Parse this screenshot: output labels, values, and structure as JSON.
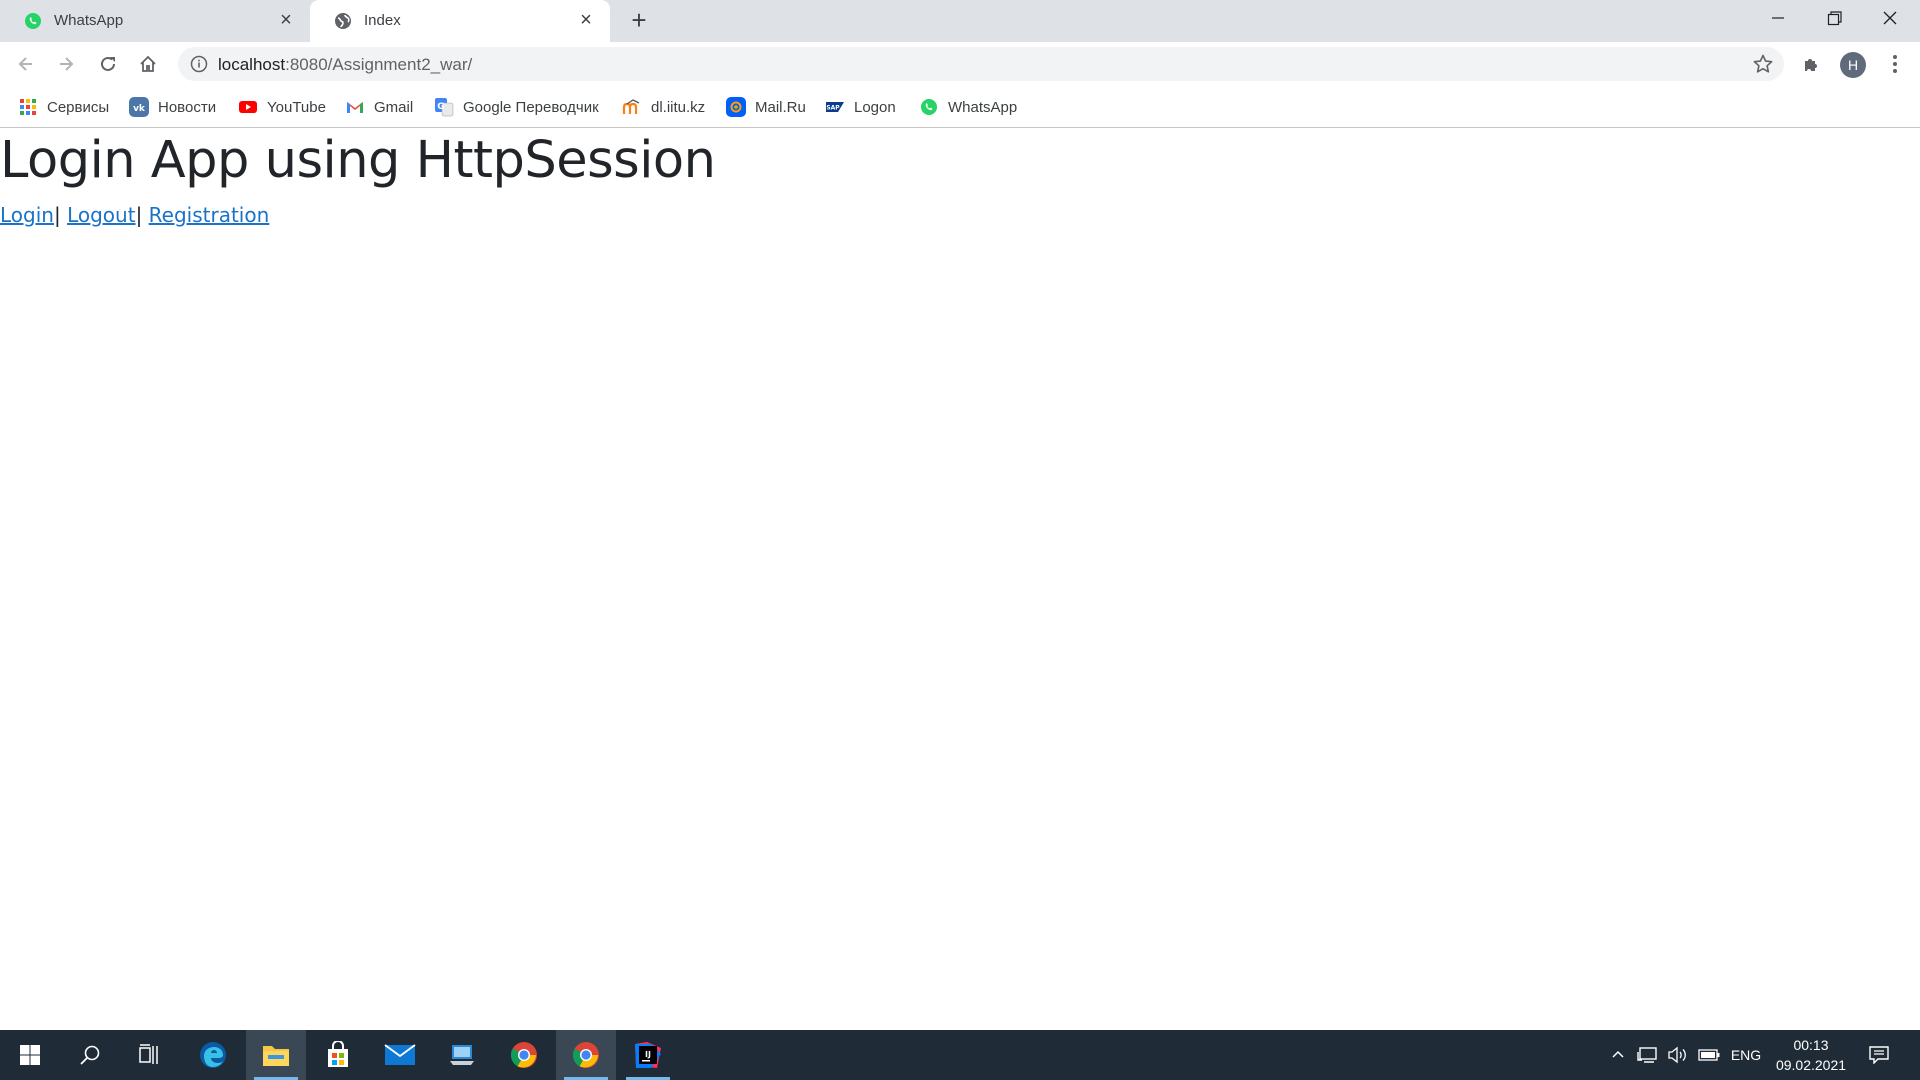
{
  "browser": {
    "tabs": [
      {
        "title": "WhatsApp",
        "icon": "whatsapp-icon",
        "active": false
      },
      {
        "title": "Index",
        "icon": "globe-icon",
        "active": true
      }
    ],
    "url_host": "localhost",
    "url_path": ":8080/Assignment2_war/",
    "profile_initial": "H"
  },
  "bookmarks": [
    {
      "label": "Сервисы",
      "icon": "apps-grid-icon"
    },
    {
      "label": "Новости",
      "icon": "vk-icon"
    },
    {
      "label": "YouTube",
      "icon": "youtube-icon"
    },
    {
      "label": "Gmail",
      "icon": "gmail-icon"
    },
    {
      "label": "Google Переводчик",
      "icon": "google-translate-icon"
    },
    {
      "label": "dl.iitu.kz",
      "icon": "moodle-icon"
    },
    {
      "label": "Mail.Ru",
      "icon": "mailru-icon"
    },
    {
      "label": "Logon",
      "icon": "sap-icon"
    },
    {
      "label": "WhatsApp",
      "icon": "whatsapp-icon"
    }
  ],
  "page": {
    "title": "Login App using HttpSession",
    "links": [
      {
        "label": "Login"
      },
      {
        "label": "Logout"
      },
      {
        "label": "Registration"
      }
    ],
    "separator": "|"
  },
  "taskbar": {
    "apps": [
      "start-icon",
      "search-icon",
      "task-view-icon",
      "edge-icon",
      "file-explorer-icon",
      "store-icon",
      "mail-icon",
      "remote-desktop-icon",
      "chrome-icon",
      "chrome-icon",
      "intellij-icon"
    ],
    "language": "ENG",
    "time": "00:13",
    "date": "09.02.2021"
  },
  "colors": {
    "tabstrip": "#dee1e6",
    "link": "#1a73c9",
    "taskbar": "#1f2b36",
    "accent": "#76b9ed"
  }
}
